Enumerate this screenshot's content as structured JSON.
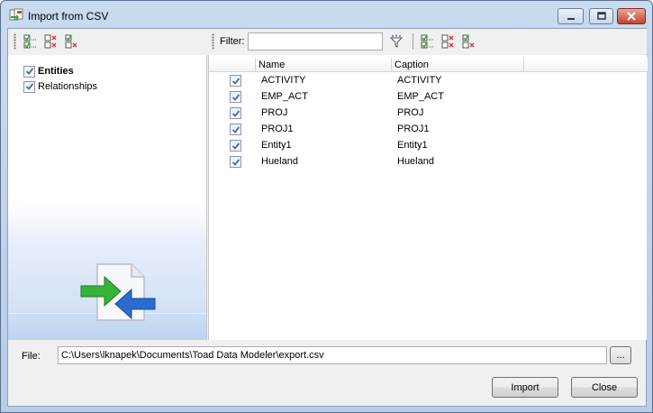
{
  "window": {
    "title": "Import from CSV",
    "controls": {
      "minimize_icon": "minimize-icon",
      "maximize_icon": "maximize-icon",
      "close_icon": "close-icon"
    }
  },
  "left_toolbar": {
    "icons": [
      "check-all-icon",
      "uncheck-all-icon",
      "invert-selection-icon"
    ]
  },
  "right_toolbar": {
    "filter_label": "Filter:",
    "filter_value": "",
    "filter_icon": "filter-funnel-icon",
    "icons": [
      "check-all-icon",
      "uncheck-all-icon",
      "invert-selection-icon"
    ]
  },
  "tree": {
    "items": [
      {
        "label": "Entities",
        "checked": true,
        "bold": true
      },
      {
        "label": "Relationships",
        "checked": true,
        "bold": false
      }
    ]
  },
  "grid": {
    "columns": [
      "Name",
      "Caption"
    ],
    "rows": [
      {
        "checked": true,
        "name": "ACTIVITY",
        "caption": "ACTIVITY"
      },
      {
        "checked": true,
        "name": "EMP_ACT",
        "caption": "EMP_ACT"
      },
      {
        "checked": true,
        "name": "PROJ",
        "caption": "PROJ"
      },
      {
        "checked": true,
        "name": "PROJ1",
        "caption": "PROJ1"
      },
      {
        "checked": true,
        "name": "Entity1",
        "caption": "Entity1"
      },
      {
        "checked": true,
        "name": "Hueland",
        "caption": "Hueland"
      }
    ]
  },
  "file": {
    "label": "File:",
    "path": "C:\\Users\\lknapek\\Documents\\Toad Data Modeler\\export.csv",
    "browse_label": "..."
  },
  "buttons": {
    "import": "Import",
    "close": "Close"
  },
  "colors": {
    "accent_green": "#2fa82f",
    "accent_blue": "#2a6ccf",
    "check_mark": "#3c6fb1"
  }
}
